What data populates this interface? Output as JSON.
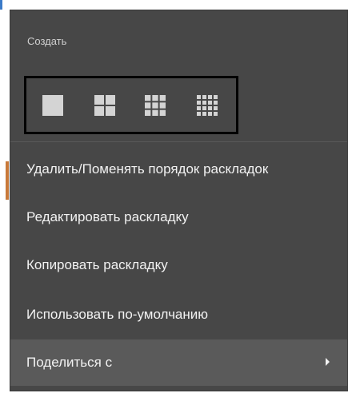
{
  "menu": {
    "create_title": "Создать",
    "layout_options": [
      {
        "name": "1x1",
        "grid": 1
      },
      {
        "name": "2x2",
        "grid": 2
      },
      {
        "name": "3x3",
        "grid": 3
      },
      {
        "name": "4x4",
        "grid": 4
      }
    ],
    "items": [
      {
        "label": "Удалить/Поменять порядок раскладок"
      },
      {
        "label": "Редактировать раскладку"
      },
      {
        "label": "Копировать раскладку"
      },
      {
        "label": "Использовать по-умолчанию"
      },
      {
        "label": "Поделиться с",
        "has_submenu": true,
        "highlighted": true
      }
    ]
  },
  "colors": {
    "menu_bg": "#474747",
    "highlight_bg": "#5a5a5a",
    "tile": "#d4d4d4",
    "box_border": "#000000"
  }
}
